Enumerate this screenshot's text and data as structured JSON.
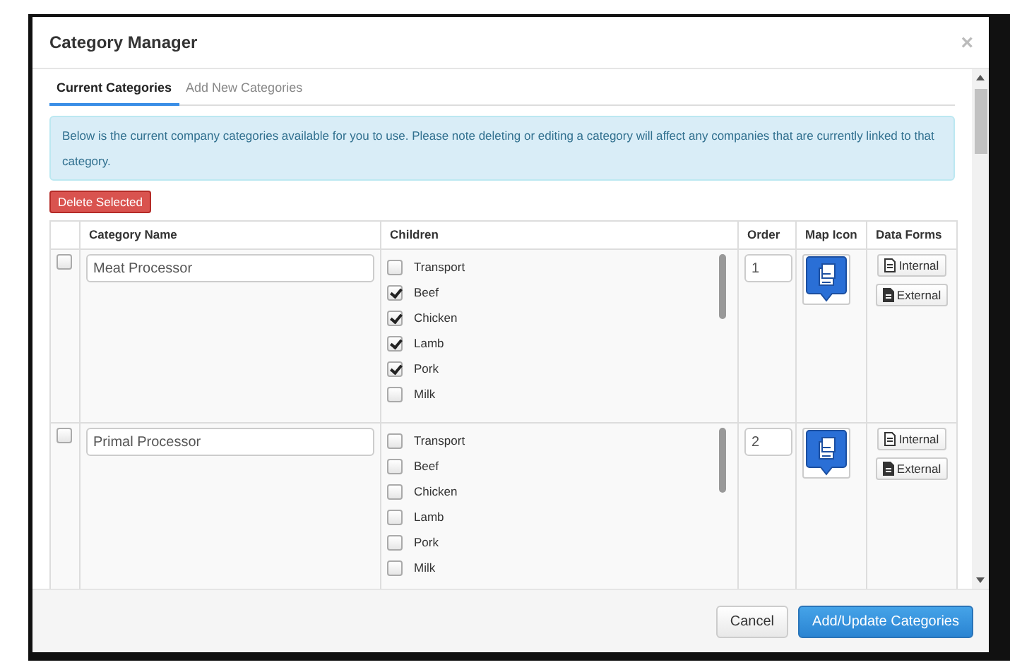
{
  "dialog": {
    "title": "Category Manager",
    "close": "×"
  },
  "tabs": [
    {
      "label": "Current Categories",
      "selected": true
    },
    {
      "label": "Add New Categories",
      "selected": false
    }
  ],
  "notice": "Below is the current company categories available for you to use. Please note deleting or editing a category will affect any companies that are currently linked to that category.",
  "delete_button": "Delete Selected",
  "table": {
    "columns": [
      "Category Name",
      "Children",
      "Order",
      "Map Icon",
      "Data Forms"
    ],
    "rows": [
      {
        "selected": false,
        "name": "Meat Processor",
        "order": "1",
        "children": [
          {
            "label": "Transport",
            "checked": false
          },
          {
            "label": "Beef",
            "checked": true
          },
          {
            "label": "Chicken",
            "checked": true
          },
          {
            "label": "Lamb",
            "checked": true
          },
          {
            "label": "Pork",
            "checked": true
          },
          {
            "label": "Milk",
            "checked": false
          }
        ],
        "forms": [
          {
            "kind": "internal",
            "label": "Internal"
          },
          {
            "kind": "external",
            "label": "External"
          }
        ]
      },
      {
        "selected": false,
        "name": "Primal Processor",
        "order": "2",
        "children": [
          {
            "label": "Transport",
            "checked": false
          },
          {
            "label": "Beef",
            "checked": false
          },
          {
            "label": "Chicken",
            "checked": false
          },
          {
            "label": "Lamb",
            "checked": false
          },
          {
            "label": "Pork",
            "checked": false
          },
          {
            "label": "Milk",
            "checked": false
          }
        ],
        "forms": [
          {
            "kind": "internal",
            "label": "Internal"
          },
          {
            "kind": "external",
            "label": "External"
          }
        ]
      }
    ]
  },
  "footer_buttons": [
    {
      "kind": "default",
      "label": "Cancel"
    },
    {
      "kind": "primary",
      "label": "Add/Update Categories"
    }
  ]
}
